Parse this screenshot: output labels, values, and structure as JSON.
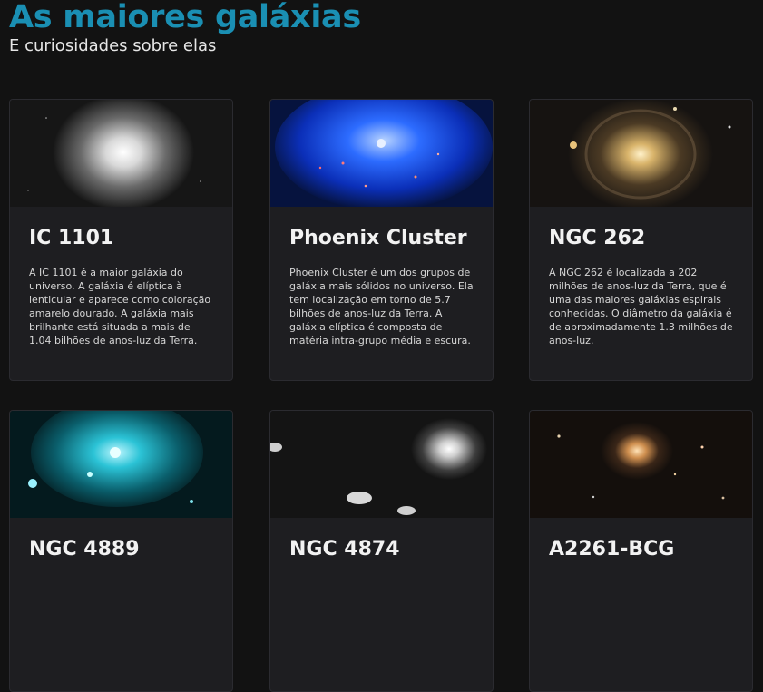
{
  "page": {
    "title": "As maiores galáxias",
    "subtitle": "E curiosidades sobre elas"
  },
  "cards": [
    {
      "title": "IC 1101",
      "text": "A IC 1101 é a maior galáxia do universo. A galáxia é elíptica à lenticular e aparece como coloração amarelo dourado. A galáxia mais brilhante está situada a mais de 1.04 bilhões de anos-luz da Terra."
    },
    {
      "title": "Phoenix Cluster",
      "text": "Phoenix Cluster é um dos grupos de galáxia mais sólidos no universo. Ela tem localização em torno de 5.7 bilhões de anos-luz da Terra. A galáxia elíptica é composta de matéria intra-grupo média e escura."
    },
    {
      "title": "NGC 262",
      "text": "A NGC 262 é localizada a 202 milhões de anos-luz da Terra, que é uma das maiores galáxias espirais conhecidas. O diâmetro da galáxia é de aproximadamente 1.3 milhões de anos-luz."
    },
    {
      "title": "NGC 4889",
      "text": ""
    },
    {
      "title": "NGC 4874",
      "text": ""
    },
    {
      "title": "A2261-BCG",
      "text": ""
    }
  ]
}
